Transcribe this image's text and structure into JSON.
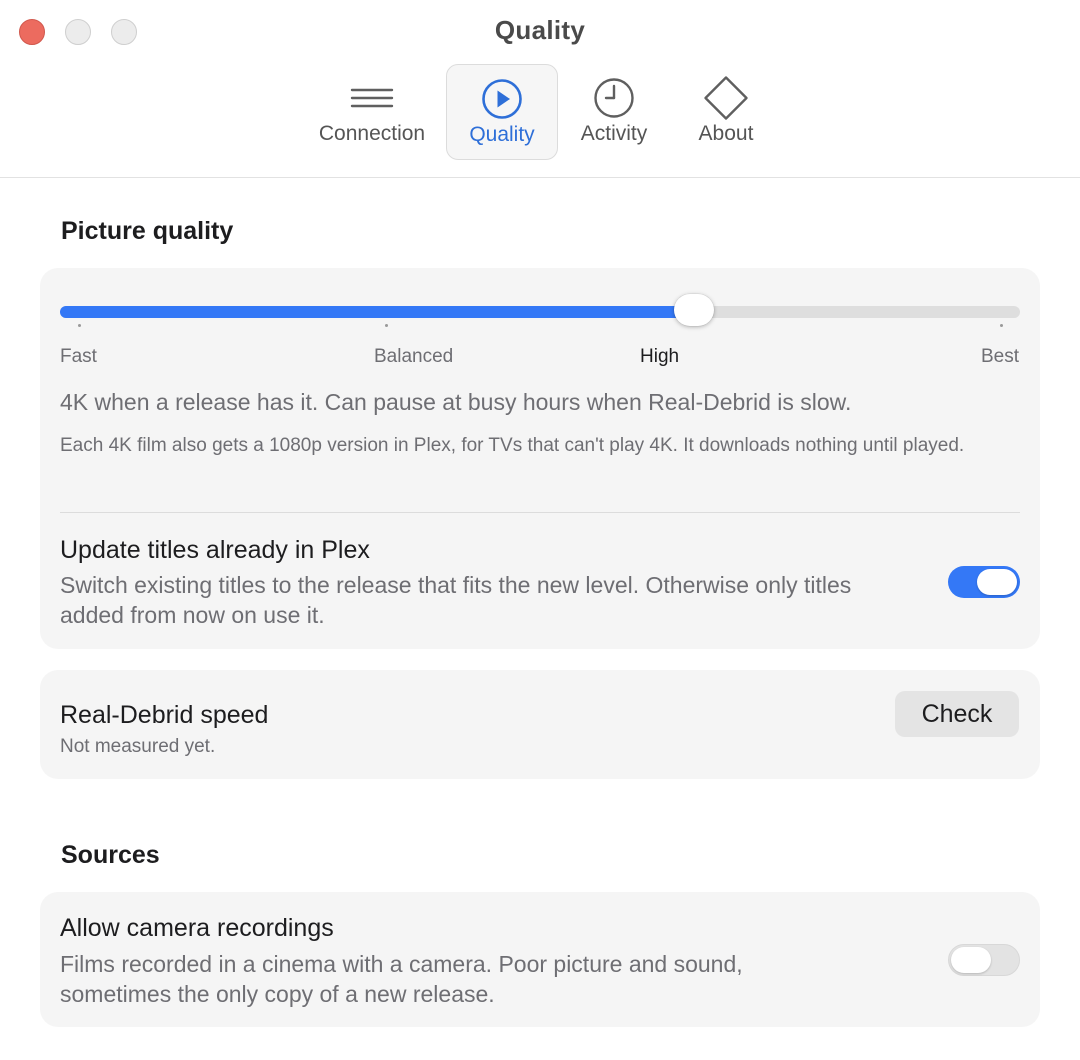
{
  "window": {
    "title": "Quality"
  },
  "toolbar": {
    "tabs": [
      {
        "label": "Connection",
        "icon": "hamburger-icon",
        "active": false
      },
      {
        "label": "Quality",
        "icon": "play-circle-icon",
        "active": true
      },
      {
        "label": "Activity",
        "icon": "clock-icon",
        "active": false
      },
      {
        "label": "About",
        "icon": "diamond-icon",
        "active": false
      }
    ]
  },
  "picture_quality": {
    "heading": "Picture quality",
    "slider": {
      "levels": [
        "Fast",
        "Balanced",
        "High",
        "Best"
      ],
      "selected": "High",
      "value_fraction": 0.66
    },
    "description": "4K when a release has it. Can pause at busy hours when Real-Debrid is slow.",
    "note": "Each 4K film also gets a 1080p version in Plex, for TVs that can't play 4K. It downloads nothing until played.",
    "update_titles": {
      "title": "Update titles already in Plex",
      "description": "Switch existing titles to the release that fits the new level. Otherwise only titles added from now on use it.",
      "enabled": true
    }
  },
  "speed": {
    "title": "Real-Debrid speed",
    "status": "Not measured yet.",
    "button_label": "Check"
  },
  "sources": {
    "heading": "Sources",
    "camera": {
      "title": "Allow camera recordings",
      "description": "Films recorded in a cinema with a camera. Poor picture and sound, sometimes the only copy of a new release.",
      "enabled": false
    }
  },
  "colors": {
    "accent": "#3478f6",
    "close_button": "#ec6b5f"
  }
}
